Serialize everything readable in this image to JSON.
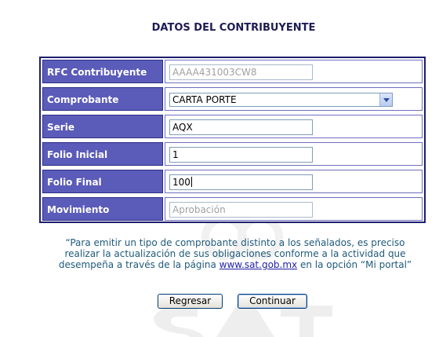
{
  "page": {
    "title": "DATOS DEL CONTRIBUYENTE"
  },
  "form": {
    "rows": [
      {
        "label": "RFC Contribuyente",
        "value": "AAAA431003CW8",
        "state": "disabled"
      },
      {
        "label": "Comprobante",
        "value": "CARTA PORTE",
        "type": "select"
      },
      {
        "label": "Serie",
        "value": "AQX"
      },
      {
        "label": "Folio Inicial",
        "value": "1"
      },
      {
        "label": "Folio Final",
        "value": "100",
        "focused": true
      },
      {
        "label": "Movimiento",
        "value": "Aprobación",
        "state": "disabled"
      }
    ]
  },
  "notice": {
    "line1": "“Para emitir un tipo de comprobante distinto a los señalados, es preciso",
    "line2": "realizar la actualización de sus obligaciones conforme a la actividad que",
    "line3_before": "desempeña a través de la página",
    "link": "www.sat.gob.mx",
    "line3_after": "en la opción “Mi portal”"
  },
  "buttons": {
    "back": "Regresar",
    "continue": "Continuar"
  },
  "colors": {
    "label_bg": "#5b5bb9",
    "border": "#1e1e6e",
    "notice_text": "#1f5a7a"
  }
}
